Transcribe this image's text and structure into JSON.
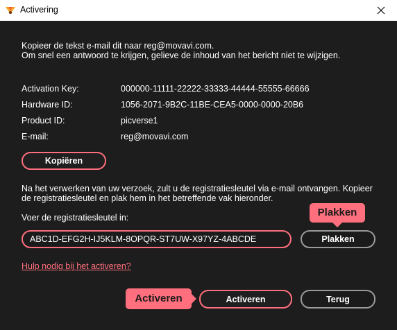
{
  "window": {
    "title": "Activering"
  },
  "intro": {
    "line1": "Kopieer de tekst e-mail dit naar reg@movavi.com.",
    "line2": "Om snel een antwoord te krijgen, gelieve de inhoud van het bericht niet te wijzigen."
  },
  "info": {
    "activation_key_label": "Activation Key:",
    "activation_key_value": "000000-11111-22222-33333-44444-55555-66666",
    "hardware_id_label": "Hardware ID:",
    "hardware_id_value": "1056-2071-9B2C-11BE-CEA5-0000-0000-20B6",
    "product_id_label": "Product ID:",
    "product_id_value": "picverse1",
    "email_label": "E-mail:",
    "email_value": "reg@movavi.com"
  },
  "buttons": {
    "copy_label": "Kopiëren",
    "paste_label": "Plakken",
    "activate_label": "Activeren",
    "back_label": "Terug"
  },
  "instructions": {
    "text": "Na het verwerken van uw verzoek, zult u de registratiesleutel via e-mail ontvangen. Kopieer de registratiesleutel en plak hem in het betreffende vak hieronder.",
    "input_label": "Voer de registratiesleutel in:"
  },
  "registration_key": {
    "value": "ABC1D-EFG2H-IJ5KLM-8OPQR-ST7UW-X97YZ-4ABCDE"
  },
  "help_link": "Hulp nodig bij het activeren?",
  "callouts": {
    "paste": "Plakken",
    "activate": "Activeren"
  },
  "colors": {
    "accent": "#ff6f7d",
    "background": "#1d1d1d",
    "button_gray_border": "#9a9a9a"
  },
  "icons": {
    "app": "movavi-logo-icon",
    "close": "close-icon"
  }
}
